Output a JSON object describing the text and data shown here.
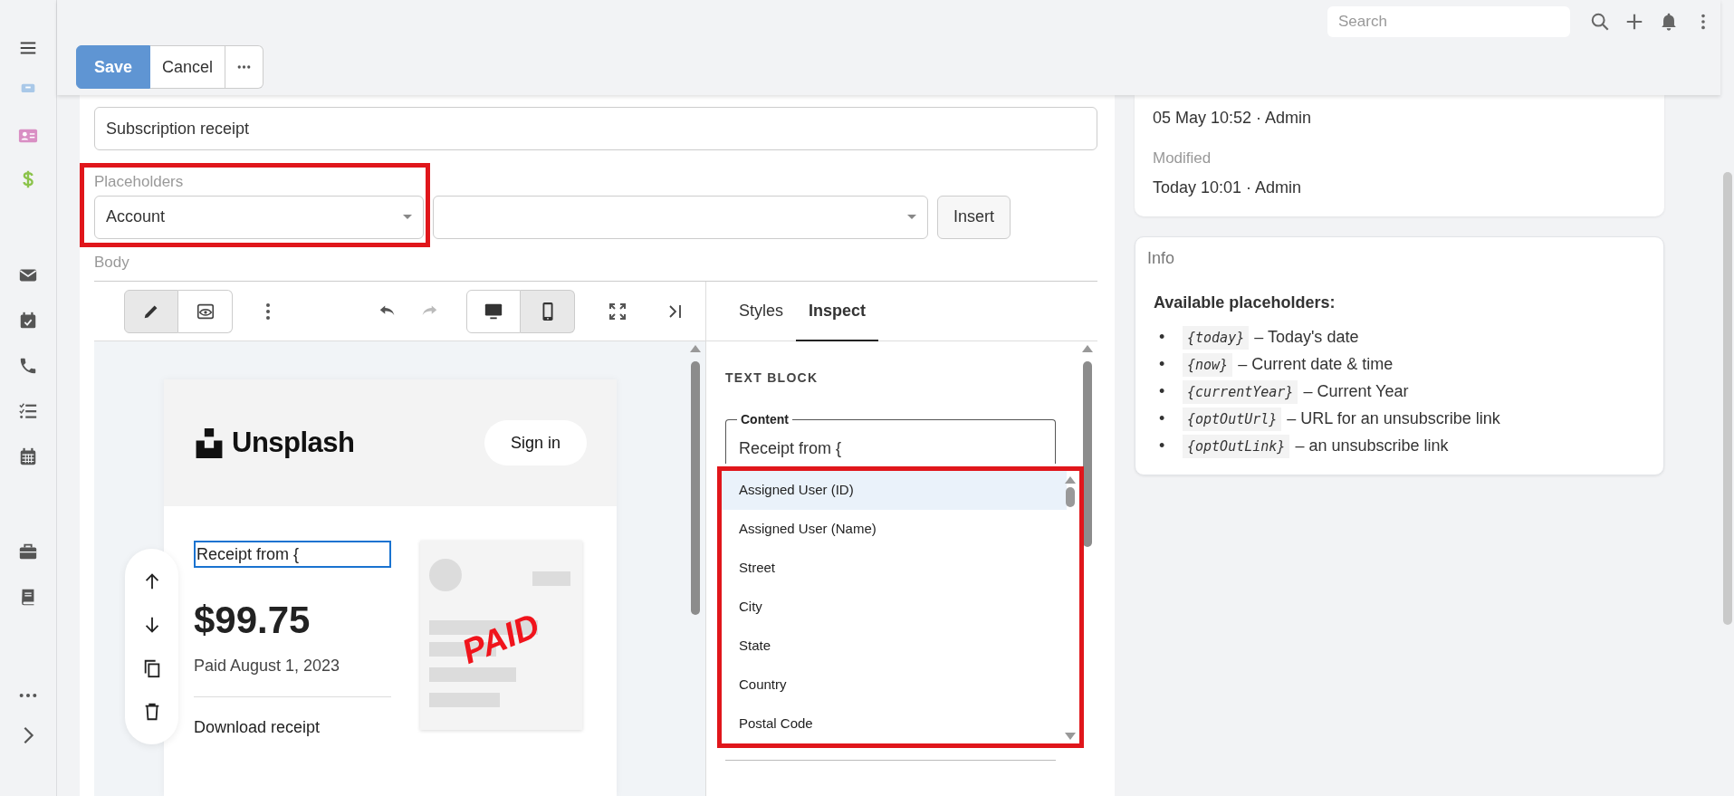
{
  "search": {
    "placeholder": "Search"
  },
  "actions": [
    {
      "label": "Save",
      "kind": "primary"
    },
    {
      "label": "Cancel",
      "kind": "default"
    },
    {
      "kind": "more"
    }
  ],
  "subject": {
    "value": "Subscription receipt"
  },
  "placeholders": {
    "label": "Placeholders",
    "entity": "Account",
    "button": "Insert"
  },
  "body": {
    "label": "Body",
    "modes": [
      {
        "kind": "edit",
        "selected": true
      },
      {
        "kind": "preview",
        "selected": false
      }
    ],
    "devices": [
      {
        "kind": "desktop",
        "selected": false
      },
      {
        "kind": "mobile",
        "selected": true
      }
    ],
    "tabs": [
      {
        "label": "Styles",
        "selected": false
      },
      {
        "label": "Inspect",
        "selected": true
      }
    ]
  },
  "email": {
    "brand": "Unsplash",
    "sign_in": "Sign in",
    "heading": "Receipt from {",
    "amount": "$99.75",
    "paid": "Paid August 1, 2023",
    "download": "Download receipt",
    "stamp": "PAID"
  },
  "inspector": {
    "section": "TEXT BLOCK",
    "content_label": "Content",
    "content_value": "Receipt from {",
    "options": [
      {
        "label": "Assigned User (ID)",
        "selected": true
      },
      {
        "label": "Assigned User (Name)",
        "selected": false
      },
      {
        "label": "Street",
        "selected": false
      },
      {
        "label": "City",
        "selected": false
      },
      {
        "label": "State",
        "selected": false
      },
      {
        "label": "Country",
        "selected": false
      },
      {
        "label": "Postal Code",
        "selected": false
      }
    ]
  },
  "meta": {
    "created": "05 May 10:52 · Admin",
    "modified_label": "Modified",
    "modified": "Today 10:01 · Admin"
  },
  "info": {
    "title": "Info",
    "heading": "Available placeholders:",
    "items": [
      {
        "bullet": "•",
        "code": "{today}",
        "text": "– Today's date"
      },
      {
        "bullet": "•",
        "code": "{now}",
        "text": "– Current date & time"
      },
      {
        "bullet": "•",
        "code": "{currentYear}",
        "text": "– Current Year"
      },
      {
        "bullet": "•",
        "code": "{optOutUrl}",
        "text": "– URL for an unsubscribe link"
      },
      {
        "bullet": "•",
        "code": "{optOutLink}",
        "text": "– an unsubscribe link"
      }
    ]
  }
}
